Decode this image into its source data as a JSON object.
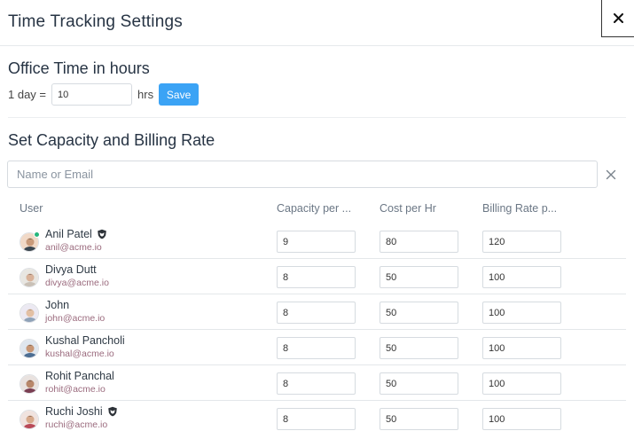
{
  "modal": {
    "title": "Time Tracking Settings"
  },
  "office": {
    "title": "Office Time in hours",
    "day_label": "1 day =",
    "hours_value": "10",
    "hrs_label": "hrs",
    "save_label": "Save"
  },
  "capacity": {
    "title": "Set Capacity and Billing Rate",
    "search_placeholder": "Name or Email",
    "columns": {
      "user": "User",
      "capacity": "Capacity per ...",
      "cost": "Cost per Hr",
      "billing": "Billing Rate p..."
    },
    "users": [
      {
        "name": "Anil Patel",
        "email": "anil@acme.io",
        "capacity": "9",
        "cost": "80",
        "billing": "120",
        "admin": true,
        "online": true
      },
      {
        "name": "Divya Dutt",
        "email": "divya@acme.io",
        "capacity": "8",
        "cost": "50",
        "billing": "100",
        "admin": false,
        "online": false
      },
      {
        "name": "John",
        "email": "john@acme.io",
        "capacity": "8",
        "cost": "50",
        "billing": "100",
        "admin": false,
        "online": false
      },
      {
        "name": "Kushal Pancholi",
        "email": "kushal@acme.io",
        "capacity": "8",
        "cost": "50",
        "billing": "100",
        "admin": false,
        "online": false
      },
      {
        "name": "Rohit Panchal",
        "email": "rohit@acme.io",
        "capacity": "8",
        "cost": "50",
        "billing": "100",
        "admin": false,
        "online": false
      },
      {
        "name": "Ruchi Joshi",
        "email": "ruchi@acme.io",
        "capacity": "8",
        "cost": "50",
        "billing": "100",
        "admin": true,
        "online": false
      }
    ]
  },
  "colors": {
    "accent": "#3ba3f5",
    "online": "#26b67c",
    "email": "#9b6b7e"
  },
  "icons": {
    "close": "close-icon",
    "clear": "clear-search-icon",
    "admin": "shield-icon",
    "avatar": "avatar"
  }
}
